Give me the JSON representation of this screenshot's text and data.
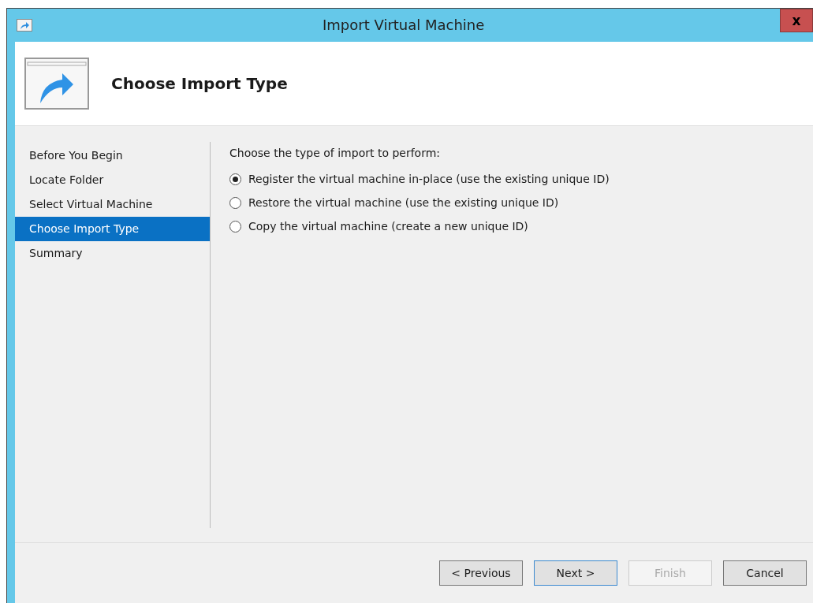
{
  "window": {
    "title": "Import Virtual Machine",
    "close": "x"
  },
  "header": {
    "title": "Choose Import Type"
  },
  "sidebar": {
    "items": [
      {
        "label": "Before You Begin",
        "selected": false
      },
      {
        "label": "Locate Folder",
        "selected": false
      },
      {
        "label": "Select Virtual Machine",
        "selected": false
      },
      {
        "label": "Choose Import Type",
        "selected": true
      },
      {
        "label": "Summary",
        "selected": false
      }
    ]
  },
  "content": {
    "prompt": "Choose the type of import to perform:",
    "options": [
      {
        "label": "Register the virtual machine in-place (use the existing unique ID)",
        "selected": true
      },
      {
        "label": "Restore the virtual machine (use the existing unique ID)",
        "selected": false
      },
      {
        "label": "Copy the virtual machine (create a new unique ID)",
        "selected": false
      }
    ]
  },
  "buttons": [
    {
      "label": "< Previous",
      "default": false,
      "disabled": false
    },
    {
      "label": "Next >",
      "default": true,
      "disabled": false
    },
    {
      "label": "Finish",
      "default": false,
      "disabled": true
    },
    {
      "label": "Cancel",
      "default": false,
      "disabled": false
    }
  ]
}
